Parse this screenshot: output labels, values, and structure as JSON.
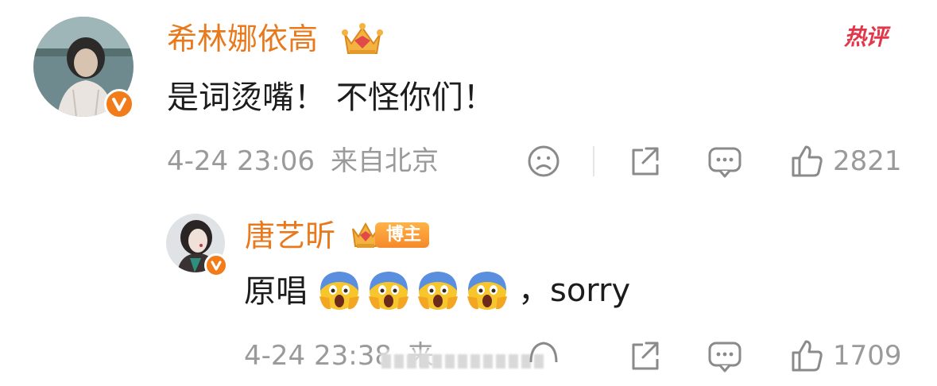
{
  "comments": [
    {
      "username": "希林娜依高",
      "text": "是词烫嘴！ 不怪你们！",
      "timestamp": "4-24 23:06",
      "location": "来自北京",
      "hot_label": "热评",
      "like_count": "2821",
      "avatar_icon": "user-avatar",
      "verified_icon": "verified-v-icon"
    },
    {
      "username": "唐艺昕",
      "badge_label": "博主",
      "text_prefix": "原唱",
      "emoji_name": "screaming-face-emoji",
      "emoji_count": 4,
      "text_suffix": "，sorry",
      "timestamp": "4-24 23:38",
      "location_partial": "来",
      "like_count": "1709",
      "avatar_icon": "user-avatar",
      "verified_icon": "verified-v-icon"
    }
  ],
  "colors": {
    "username": "#e8791c",
    "hot": "#e2364a",
    "meta": "#9a9a9a",
    "verified": "#f27b1a"
  }
}
